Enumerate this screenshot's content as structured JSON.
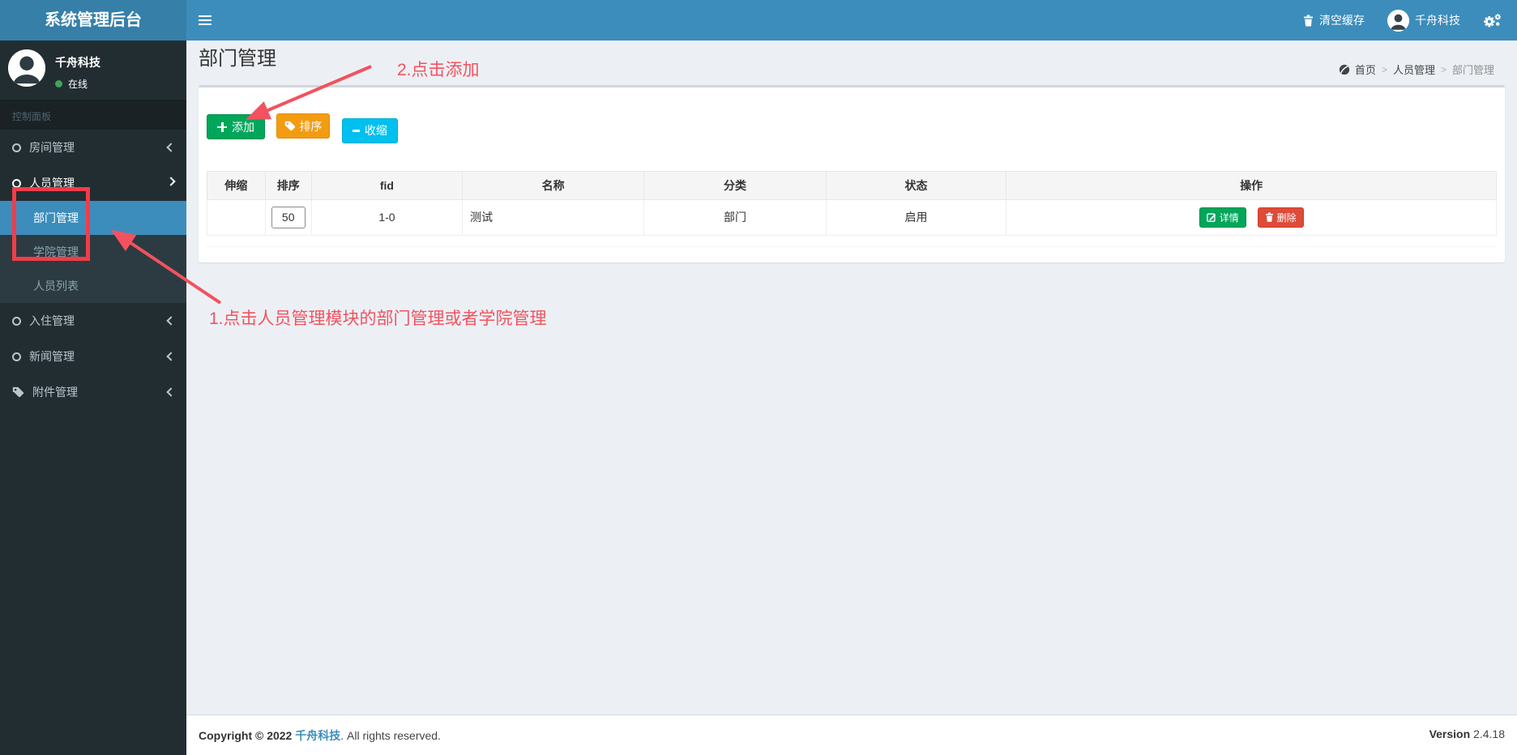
{
  "app": {
    "title": "系统管理后台"
  },
  "navbar": {
    "clear_cache": "清空缓存",
    "user_name": "千舟科技"
  },
  "sidebar": {
    "user": {
      "name": "千舟科技",
      "status": "在线"
    },
    "section_label": "控制面板",
    "items": [
      {
        "label": "房间管理"
      },
      {
        "label": "人员管理",
        "children": [
          {
            "label": "部门管理"
          },
          {
            "label": "学院管理"
          },
          {
            "label": "人员列表"
          }
        ]
      },
      {
        "label": "入住管理"
      },
      {
        "label": "新闻管理"
      },
      {
        "label": "附件管理"
      }
    ]
  },
  "page": {
    "title": "部门管理",
    "breadcrumb": {
      "home": "首页",
      "section": "人员管理",
      "current": "部门管理",
      "separator": ">"
    }
  },
  "toolbar": {
    "add": "添加",
    "sort": "排序",
    "collapse": "收缩"
  },
  "table": {
    "headers": [
      "伸缩",
      "排序",
      "fid",
      "名称",
      "分类",
      "状态",
      "操作"
    ],
    "row": {
      "expand": "",
      "sort_value": "50",
      "fid": "1-0",
      "name": "测试",
      "category": "部门",
      "status": "启用",
      "detail_label": "详情",
      "delete_label": "删除"
    }
  },
  "annotations": {
    "step1": "1.点击人员管理模块的部门管理或者学院管理",
    "step2": "2.点击添加"
  },
  "footer": {
    "copyright": "Copyright © 2022",
    "company": "千舟科技",
    "rights": ". All rights reserved.",
    "version_label": "Version",
    "version": "2.4.18"
  },
  "colors": {
    "navbar": "#3c8dbc",
    "logo_bg": "#367fa9",
    "sidebar": "#222d32",
    "active_item": "#3c8dbc",
    "green": "#00a65a",
    "orange": "#f39c12",
    "cyan": "#00c0ef",
    "danger": "#dd4b39",
    "annotation_red": "#f2525f"
  }
}
